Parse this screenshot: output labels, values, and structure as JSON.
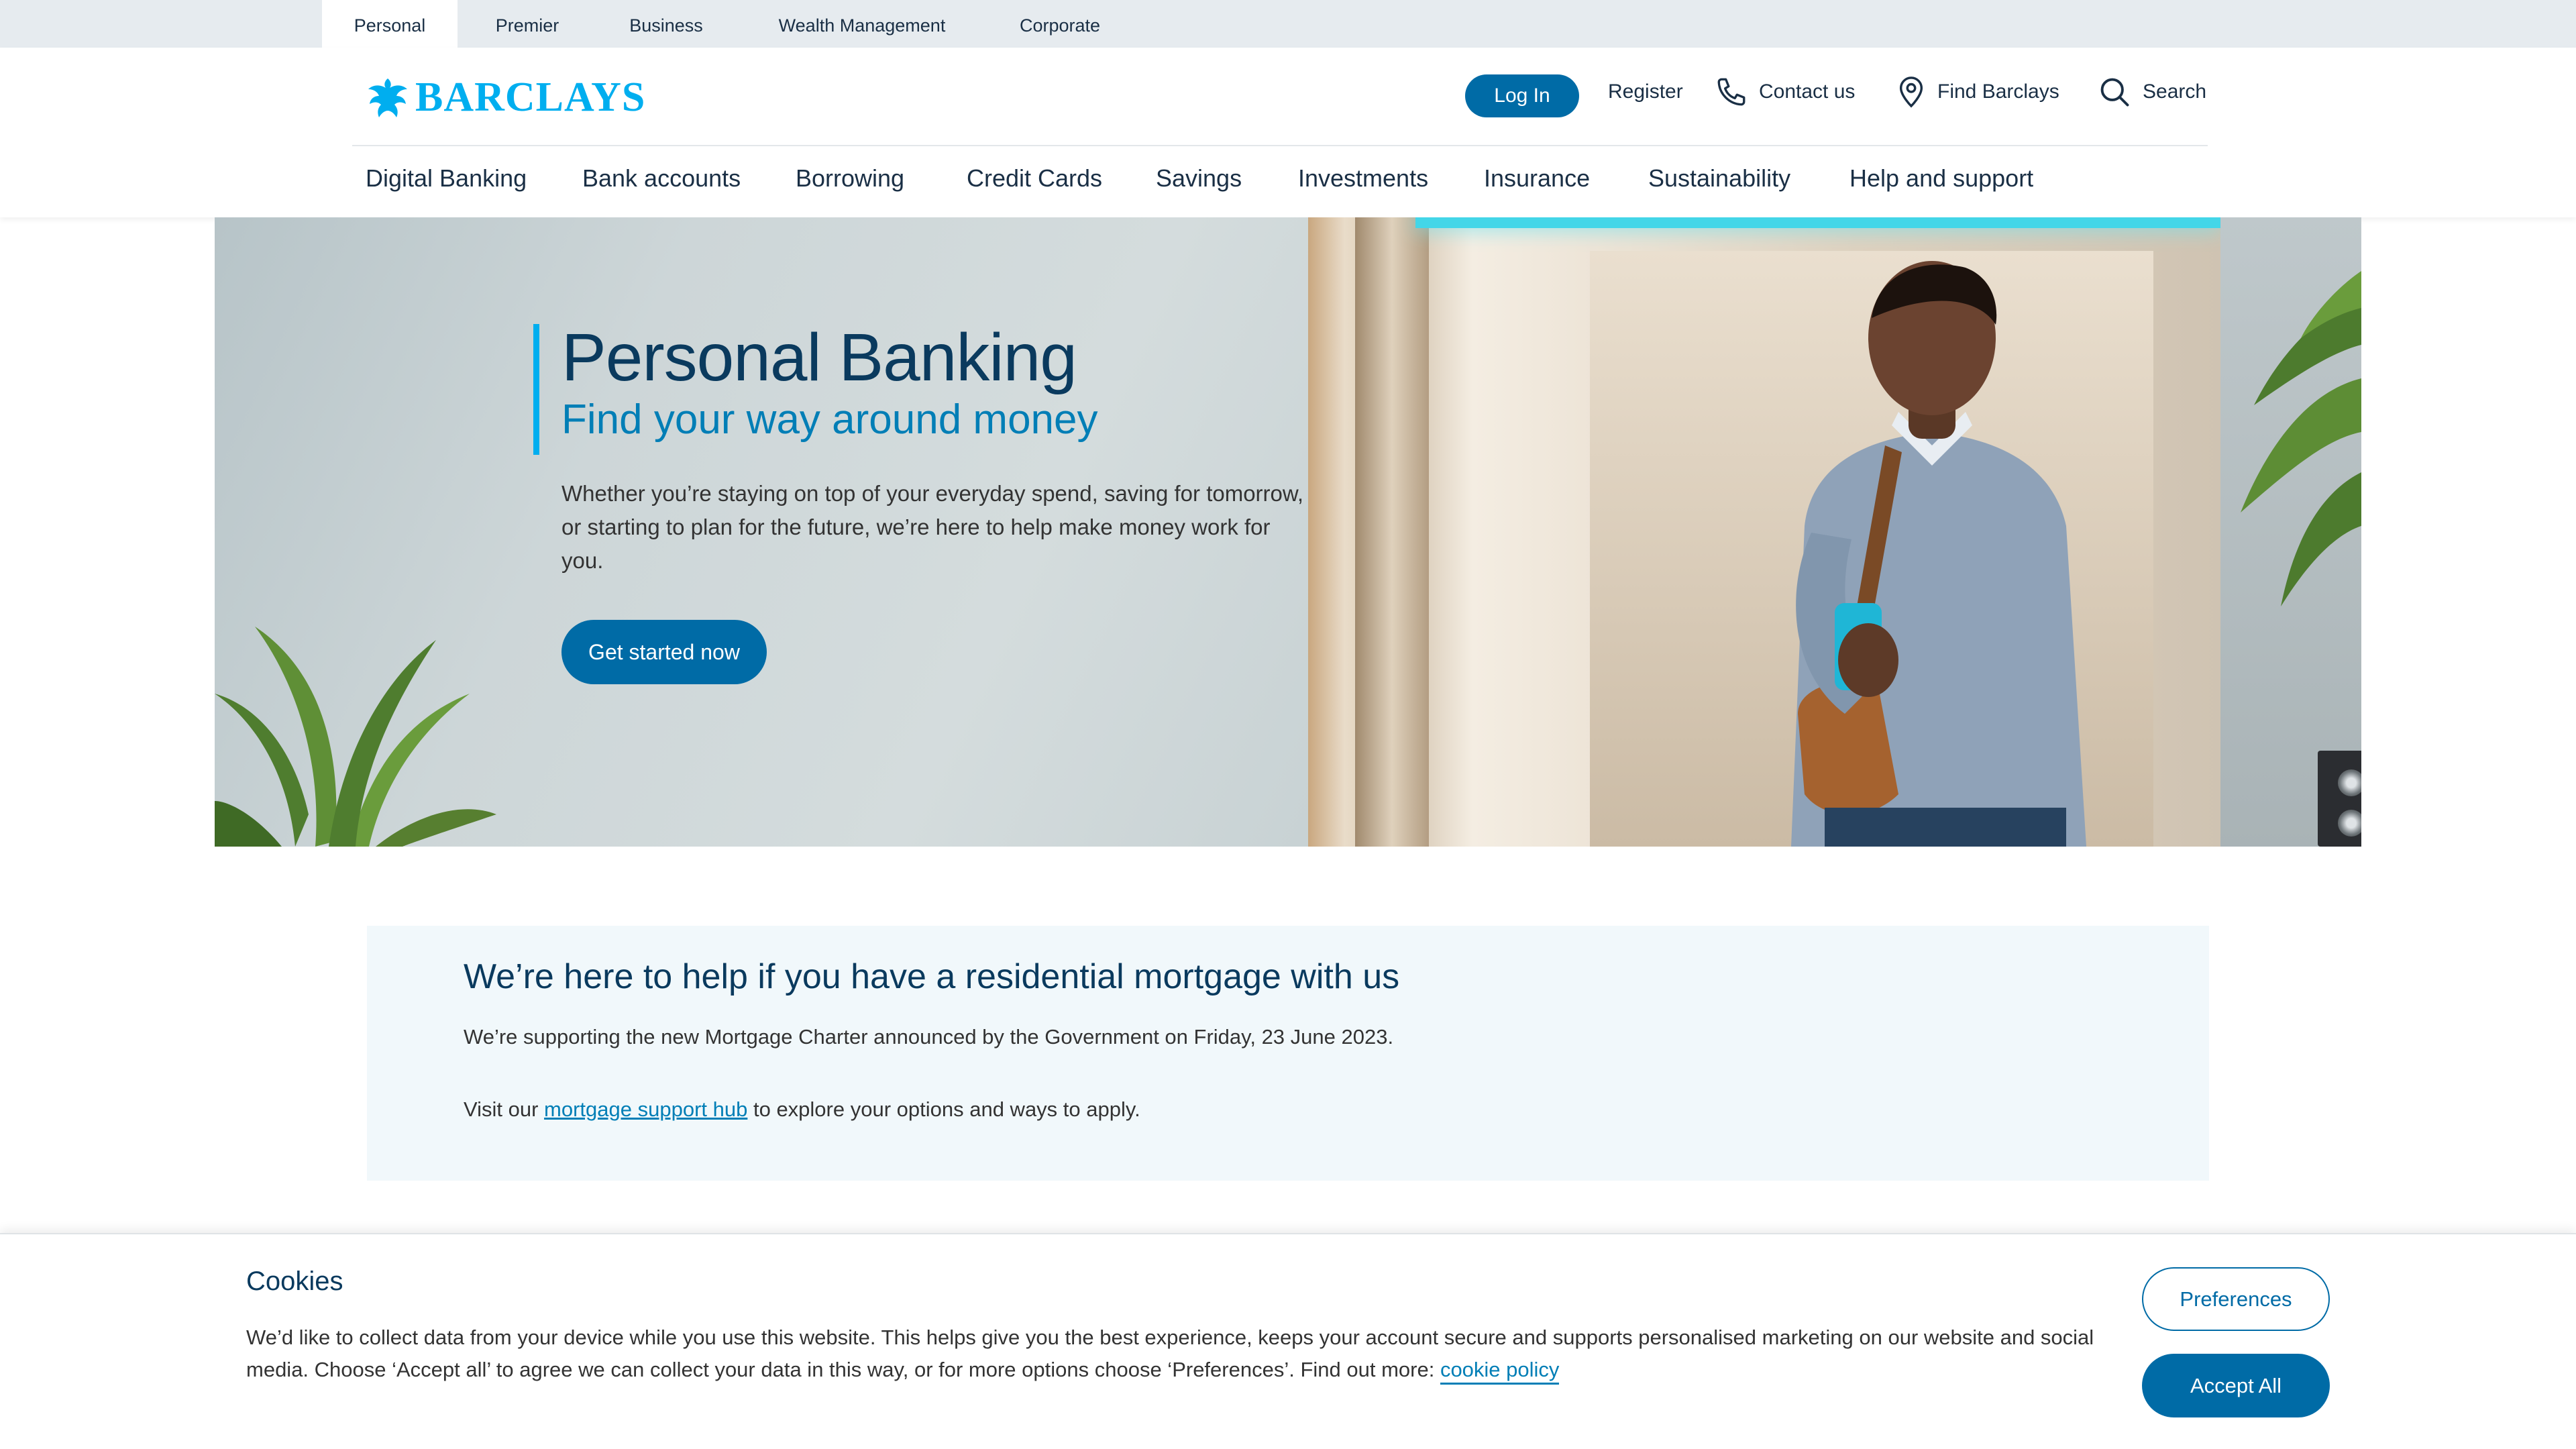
{
  "segments": {
    "items": [
      {
        "label": "Personal",
        "active": true
      },
      {
        "label": "Premier",
        "active": false
      },
      {
        "label": "Business",
        "active": false
      },
      {
        "label": "Wealth Management",
        "active": false
      },
      {
        "label": "Corporate",
        "active": false
      }
    ]
  },
  "header": {
    "logo_text": "BARCLAYS",
    "login_label": "Log In",
    "register_label": "Register",
    "contact_label": "Contact us",
    "find_label": "Find Barclays",
    "search_label": "Search"
  },
  "main_nav": {
    "items": [
      "Digital Banking",
      "Bank accounts",
      "Borrowing",
      "Credit Cards",
      "Savings",
      "Investments",
      "Insurance",
      "Sustainability",
      "Help and support"
    ]
  },
  "hero": {
    "title": "Personal Banking",
    "subtitle": "Find your way around money",
    "body": "Whether you’re staying on top of your everyday spend, saving for tomorrow, or starting to plan for the future, we’re here to help make money work for you.",
    "cta_label": "Get started now"
  },
  "notice": {
    "heading": "We’re here to help if you have a residential mortgage with us",
    "line1": "We’re supporting the new Mortgage Charter announced by the Government on Friday, 23 June 2023.",
    "line2_prefix": "Visit our ",
    "line2_link": "mortgage support hub",
    "line2_suffix": " to explore your options and ways to apply."
  },
  "cookie": {
    "title": "Cookies",
    "text": "We’d like to collect data from your device while you use this website. This helps give you the best experience, keeps your account secure and supports personalised marketing on our website and social media. Choose ‘Accept all’ to agree we can collect your data in this way, or for more options choose ‘Preferences’. Find out more: ",
    "link_label": "cookie policy",
    "preferences_label": "Preferences",
    "accept_label": "Accept All"
  },
  "colors": {
    "brand_cyan": "#00aeef",
    "primary_button": "#006ba6",
    "heading_navy": "#0a3a5e",
    "link_blue": "#007eb6",
    "segment_bar": "#e6ebef",
    "notice_bg": "#f1f8fb"
  },
  "icons": {
    "logo": "eagle-icon",
    "contact": "phone-icon",
    "find": "location-pin-icon",
    "search": "search-icon"
  }
}
